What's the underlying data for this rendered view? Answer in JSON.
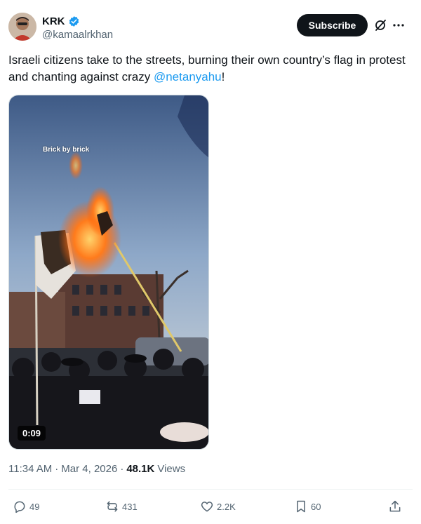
{
  "author": {
    "name": "KRK",
    "handle": "@kamaalrkhan",
    "verified": true
  },
  "header": {
    "subscribe_label": "Subscribe",
    "grok_icon": "grok-icon",
    "more_icon": "more-icon"
  },
  "post": {
    "text_before": "Israeli citizens take to the streets, burning their own country’s flag in protest and chanting against crazy ",
    "mention": "@netanyahu",
    "text_after": "!"
  },
  "media": {
    "caption": "Brick by brick",
    "duration": "0:09"
  },
  "meta": {
    "time": "11:34 AM",
    "separator1": "·",
    "date": "Mar 4, 2026",
    "separator2": "·",
    "views_count": "48.1K",
    "views_label": "Views"
  },
  "actions": {
    "replies": "49",
    "reposts": "431",
    "likes": "2.2K",
    "bookmarks": "60"
  },
  "colors": {
    "accent": "#1d9bf0",
    "text": "#0f1419",
    "secondary": "#536471"
  }
}
